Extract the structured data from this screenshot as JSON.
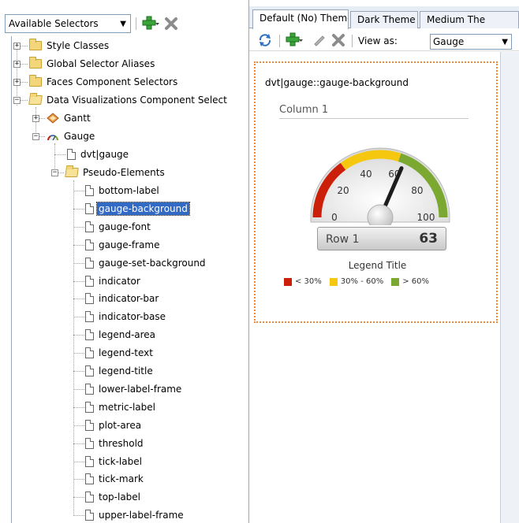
{
  "left": {
    "selector_dropdown": "Available Selectors",
    "tree": {
      "top_level": [
        {
          "label": "Style Classes"
        },
        {
          "label": "Global Selector Aliases"
        },
        {
          "label": "Faces Component Selectors"
        },
        {
          "label": "Data Visualizations Component Select"
        }
      ],
      "dv_children": [
        {
          "label": "Gantt"
        },
        {
          "label": "Gauge"
        }
      ],
      "gauge_children": [
        {
          "label": "dvt|gauge"
        },
        {
          "label": "Pseudo-Elements"
        }
      ],
      "pseudo_elements": [
        "bottom-label",
        "gauge-background",
        "gauge-font",
        "gauge-frame",
        "gauge-set-background",
        "indicator",
        "indicator-bar",
        "indicator-base",
        "legend-area",
        "legend-text",
        "legend-title",
        "lower-label-frame",
        "metric-label",
        "plot-area",
        "threshold",
        "tick-label",
        "tick-mark",
        "top-label",
        "upper-label-frame"
      ],
      "selected": "gauge-background"
    }
  },
  "right": {
    "tabs": [
      "Default (No) Theme",
      "Dark Theme",
      "Medium The"
    ],
    "view_as_label": "View as:",
    "view_as_value": "Gauge",
    "preview": {
      "selector_title": "dvt|gauge::gauge-background",
      "column_label": "Column 1",
      "tick_labels": [
        "0",
        "20",
        "40",
        "60",
        "80",
        "100"
      ],
      "row_label": "Row 1",
      "metric_value": "63",
      "gauge": {
        "min": 0,
        "max": 100,
        "value": 63,
        "thresholds": [
          {
            "from": 0,
            "to": 30,
            "color": "#cc1f0a"
          },
          {
            "from": 30,
            "to": 60,
            "color": "#f5c70f"
          },
          {
            "from": 60,
            "to": 100,
            "color": "#7aa831"
          }
        ]
      },
      "legend_title": "Legend Title",
      "legend": [
        {
          "label": "< 30%",
          "color": "#cc1f0a"
        },
        {
          "label": "30% - 60%",
          "color": "#f5c70f"
        },
        {
          "label": "> 60%",
          "color": "#7aa831"
        }
      ]
    }
  },
  "icons": {
    "add": "plus-icon",
    "delete": "x-icon",
    "refresh": "refresh-icon",
    "edit": "pencil-icon"
  }
}
